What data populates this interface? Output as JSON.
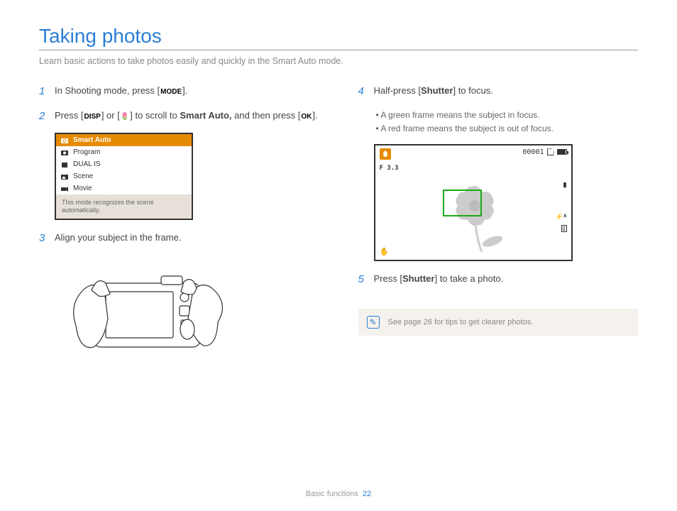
{
  "title": "Taking photos",
  "subtitle": "Learn basic actions to take photos easily and quickly in the Smart Auto mode.",
  "steps": {
    "s1_pre": "In Shooting mode, press [",
    "s1_btn": "MODE",
    "s1_post": "].",
    "s2_pre": "Press [",
    "s2_btn1": "DISP",
    "s2_mid1": "] or [",
    "s2_btn2": "🌷",
    "s2_mid2": "] to scroll to ",
    "s2_bold": "Smart Auto,",
    "s2_mid3": " and then press [",
    "s2_btn3": "OK",
    "s2_post": "].",
    "s3": "Align your subject in the frame.",
    "s4_pre": "Half-press [",
    "s4_bold": "Shutter",
    "s4_post": "] to focus.",
    "s4_b1": "A green frame means the subject in focus.",
    "s4_b2": "A red frame means the subject is out of focus.",
    "s5_pre": "Press [",
    "s5_bold": "Shutter",
    "s5_post": "] to take a photo."
  },
  "menu": {
    "items": [
      "Smart Auto",
      "Program",
      "DUAL IS",
      "Scene",
      "Movie"
    ],
    "desc": "This mode recognizes the scene automatically."
  },
  "lcd": {
    "counter": "00001",
    "fstop": "F 3.3"
  },
  "note": "See page 26 for tips to get clearer photos.",
  "footer": {
    "section": "Basic functions",
    "page": "22"
  }
}
